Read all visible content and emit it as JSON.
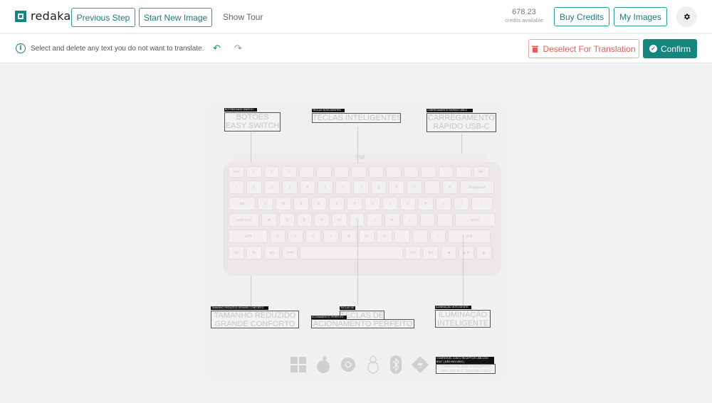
{
  "header": {
    "logo_text": "redaka",
    "previous_step": "Previous Step",
    "start_new_image": "Start New Image",
    "show_tour": "Show Tour",
    "credits_value": "678.23",
    "credits_label": "credits available",
    "buy_credits": "Buy Credits",
    "my_images": "My Images"
  },
  "toolbar": {
    "hint": "Select and delete any text you do not want to translate.",
    "deselect": "Deselect For Translation",
    "confirm": "Confirm"
  },
  "colors": {
    "accent": "#15867d",
    "danger": "#ea5a5a"
  },
  "image": {
    "logo": "logi",
    "labels": [
      {
        "tag": "BOTÕES EASY SWITCH",
        "text1": "BOTÕES",
        "text2": "EASY SWITCH"
      },
      {
        "tag": "TECLAS INTELIGENTES",
        "text1": "TECLAS INTELIGENTES",
        "text2": ""
      },
      {
        "tag": "CARREGAMENTO RÁPIDO USB-C",
        "text1": "CARREGAMENTO",
        "text2": "RÁPIDO USB-C"
      },
      {
        "tag": "TAMANHO REDUZIDO GRANDE CONFORTO",
        "text1": "TAMANHO REDUZIDO",
        "text2": "GRANDE CONFORTO"
      },
      {
        "tag": "TECLAS DE",
        "text1": "TECLAS DE",
        "text2": ""
      },
      {
        "tag": "ACIONAMENTO PERFEITO",
        "text1": "ACIONAMENTO PERFEITO",
        "text2": ""
      },
      {
        "tag": "ILUMINAÇÃO INTELIGENTE",
        "text1": "ILUMINAÇÃO",
        "text2": "INTELIGENTE"
      },
      {
        "tag": "COMPATÍVEL COM O RECEPTOR USB LOGI BOLT ( NÃO INCLUÍDO )",
        "text1": "COMPATÍVEL COM O RECEPTOR",
        "text2": "USB LOGI BOLT (NÃO INCLUÍDO)"
      }
    ],
    "keyboard_rows": [
      [
        "esc",
        "1",
        "2",
        "3",
        "",
        "",
        "",
        "",
        "",
        "",
        "",
        "",
        "",
        "",
        "del"
      ],
      [
        "~",
        "1",
        "2",
        "3",
        "4",
        "5",
        "6",
        "7",
        "8",
        "9",
        "0",
        "-",
        "=",
        "backspace"
      ],
      [
        "tab",
        "Q",
        "W",
        "E",
        "R",
        "T",
        "Y",
        "U",
        "I",
        "O",
        "P",
        "[",
        "]",
        "\\"
      ],
      [
        "caps lock",
        "A",
        "S",
        "D",
        "F",
        "G",
        "H",
        "J",
        "K",
        "L",
        ";",
        "'",
        "enter"
      ],
      [
        "shift",
        "Z",
        "X",
        "C",
        "V",
        "B",
        "N",
        "M",
        ",",
        ".",
        "/",
        "shift"
      ],
      [
        "ctrl",
        "fn",
        "opt",
        "cmd",
        "",
        "cmd",
        "opt",
        "◀",
        "▲▼",
        "▶"
      ]
    ],
    "os_icons": [
      "windows-icon",
      "apple-icon",
      "chrome-icon",
      "linux-icon",
      "bluetooth-icon",
      "logi-bolt-icon"
    ]
  }
}
